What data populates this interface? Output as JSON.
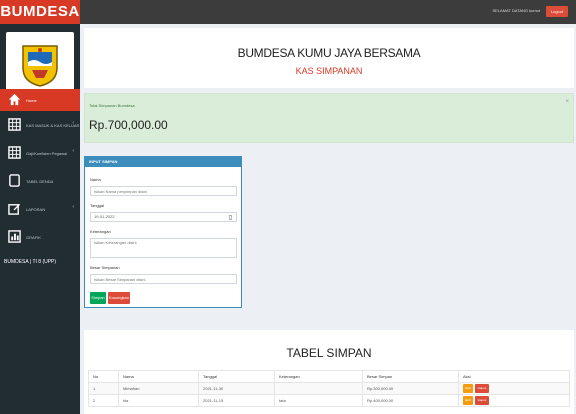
{
  "app": {
    "brand": "BUMDESA",
    "welcome": "SELAMAT DATANG kumut",
    "logout_label": "Logout"
  },
  "sidebar": {
    "items": [
      {
        "label": "Home",
        "icon": "home-icon",
        "active": true
      },
      {
        "label": "KAS MASUK & KAS KELUAR",
        "icon": "table-icon"
      },
      {
        "label": "Gaji/Koefisien Pegawai",
        "icon": "table-icon"
      },
      {
        "label": "TABEL DENDA",
        "icon": "doc-icon"
      },
      {
        "label": "LAPORAN",
        "icon": "edit-icon"
      },
      {
        "label": "GRAFIK",
        "icon": "chart-icon"
      }
    ],
    "footer": "BUMDESA | TI 8 (UPP)"
  },
  "header": {
    "company": "BUMDESA KUMU JAYA BERSAMA",
    "subtitle": "KAS SIMPANAN"
  },
  "summary": {
    "label": "Total Simpanan Bumdesa",
    "value": "Rp.700,000.00",
    "close": "×"
  },
  "form": {
    "title": "INPUT SIMPAN",
    "nama_label": "Nama",
    "nama_placeholder": "Isikan Nama penyimpan disini",
    "tanggal_label": "Tanggal",
    "tanggal_value": "19-01-2022",
    "keterangan_label": "Keterangan",
    "keterangan_placeholder": "Isikan Keterangan disini",
    "besar_label": "Besar Simpanan",
    "besar_placeholder": "Isikan Besar Simpanan disini",
    "save_label": "Simpan",
    "cancel_label": "Kosongkan"
  },
  "table": {
    "title": "TABEL SIMPAN",
    "columns": [
      "No",
      "Nama",
      "Tanggal",
      "Keterangan",
      "Besar Simpan",
      "Aksi"
    ],
    "rows": [
      {
        "no": "1",
        "nama": "Mimahan",
        "tanggal": "2021-11-30",
        "keterangan": "",
        "besar": "Rp.300,000.00"
      },
      {
        "no": "2",
        "nama": "ida",
        "tanggal": "2021-11-15",
        "keterangan": "tata",
        "besar": "Rp.400,000.00"
      }
    ],
    "edit_label": "Edit",
    "delete_label": "Hapus"
  }
}
